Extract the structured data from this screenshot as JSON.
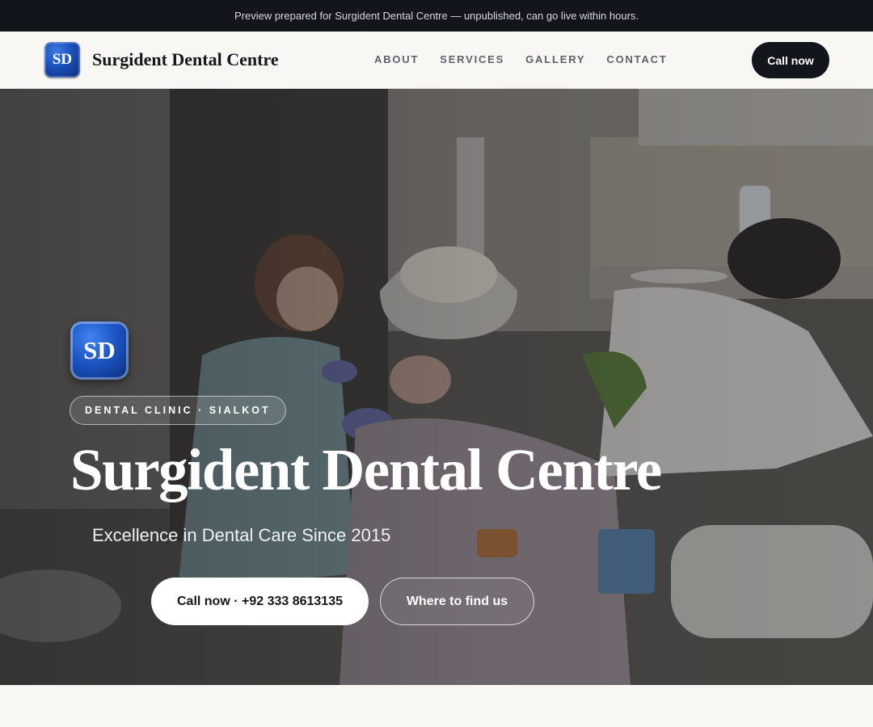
{
  "banner": {
    "text": "Preview prepared for Surgident Dental Centre — unpublished, can go live within hours."
  },
  "header": {
    "logo_initials": "SD",
    "brand_name": "Surgident Dental Centre",
    "nav": [
      "ABOUT",
      "SERVICES",
      "GALLERY",
      "CONTACT"
    ],
    "call_label": "Call now"
  },
  "hero": {
    "logo_initials": "SD",
    "eyebrow": "DENTAL CLINIC · SIALKOT",
    "title": "Surgident Dental Centre",
    "tagline": "Excellence in Dental Care Since 2015",
    "primary_cta": "Call now · +92 333 8613135",
    "secondary_cta": "Where to find us",
    "photo_description_icon": "dental-procedure-photo"
  },
  "colors": {
    "topbar_bg": "#12151b",
    "logo_blue": "#1a4fb8",
    "dark_button": "#12151b",
    "page_bg": "#f8f7f3"
  }
}
